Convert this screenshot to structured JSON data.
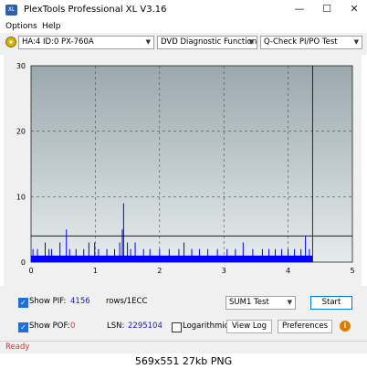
{
  "window": {
    "title": "PlexTools Professional XL V3.16",
    "app_icon_text": "XL",
    "minimize": "—",
    "maximize": "☐",
    "close": "✕"
  },
  "menu": {
    "options": "Options",
    "help": "Help"
  },
  "toolbar": {
    "drive": "HA:4 ID:0  PX-760A",
    "function": "DVD Diagnostic Functions",
    "test": "Q-Check PI/PO Test"
  },
  "chart_data": {
    "type": "bar",
    "xlim": [
      0,
      5
    ],
    "ylim": [
      0,
      30
    ],
    "x_ticks": [
      "0",
      "1",
      "2",
      "3",
      "4",
      "5"
    ],
    "y_ticks": [
      "0",
      "10",
      "20",
      "30"
    ],
    "threshold": 4,
    "data_end": 4.38,
    "grid": true,
    "background_top": "#9aa8ad",
    "background_bottom": "#e6eced",
    "series_color": "#0000ff",
    "baseline_level": 1,
    "peaks": [
      {
        "x": 0.03,
        "y": 2
      },
      {
        "x": 0.1,
        "y": 2
      },
      {
        "x": 0.22,
        "y": 3
      },
      {
        "x": 0.28,
        "y": 2
      },
      {
        "x": 0.32,
        "y": 2
      },
      {
        "x": 0.45,
        "y": 3
      },
      {
        "x": 0.55,
        "y": 5
      },
      {
        "x": 0.6,
        "y": 2
      },
      {
        "x": 0.7,
        "y": 2
      },
      {
        "x": 0.82,
        "y": 2
      },
      {
        "x": 0.9,
        "y": 3
      },
      {
        "x": 0.99,
        "y": 3
      },
      {
        "x": 1.05,
        "y": 2
      },
      {
        "x": 1.18,
        "y": 2
      },
      {
        "x": 1.3,
        "y": 2
      },
      {
        "x": 1.38,
        "y": 3
      },
      {
        "x": 1.42,
        "y": 5
      },
      {
        "x": 1.44,
        "y": 9
      },
      {
        "x": 1.5,
        "y": 3
      },
      {
        "x": 1.55,
        "y": 2
      },
      {
        "x": 1.62,
        "y": 3
      },
      {
        "x": 1.75,
        "y": 2
      },
      {
        "x": 1.85,
        "y": 2
      },
      {
        "x": 2.0,
        "y": 2
      },
      {
        "x": 2.15,
        "y": 2
      },
      {
        "x": 2.3,
        "y": 2
      },
      {
        "x": 2.38,
        "y": 3
      },
      {
        "x": 2.5,
        "y": 2
      },
      {
        "x": 2.62,
        "y": 2
      },
      {
        "x": 2.75,
        "y": 2
      },
      {
        "x": 2.9,
        "y": 2
      },
      {
        "x": 3.05,
        "y": 2
      },
      {
        "x": 3.18,
        "y": 2
      },
      {
        "x": 3.3,
        "y": 3
      },
      {
        "x": 3.45,
        "y": 2
      },
      {
        "x": 3.6,
        "y": 2
      },
      {
        "x": 3.7,
        "y": 2
      },
      {
        "x": 3.8,
        "y": 2
      },
      {
        "x": 3.9,
        "y": 2
      },
      {
        "x": 4.0,
        "y": 2
      },
      {
        "x": 4.1,
        "y": 2
      },
      {
        "x": 4.2,
        "y": 2
      },
      {
        "x": 4.27,
        "y": 4
      },
      {
        "x": 4.33,
        "y": 2
      }
    ]
  },
  "stats": {
    "show_pif_label": "Show PIF:",
    "pif_value": "4156",
    "pif_unit": "rows/1ECC",
    "show_pof_label": "Show POF:",
    "pof_value": "0",
    "lsn_label": "LSN:",
    "lsn_value": "2295104",
    "logarithmic_label": "Logarithmic",
    "sum_select": "SUM1 Test",
    "start_label": "Start",
    "view_log_label": "View Log",
    "preferences_label": "Preferences",
    "info_icon_glyph": "i"
  },
  "status": {
    "text": "Ready"
  },
  "caption": "569x551  27kb  PNG",
  "colors": {
    "accent": "#1f6fd6",
    "status_red": "#e03030",
    "pof_red": "#e03030",
    "value_blue": "#1a1ab0"
  }
}
